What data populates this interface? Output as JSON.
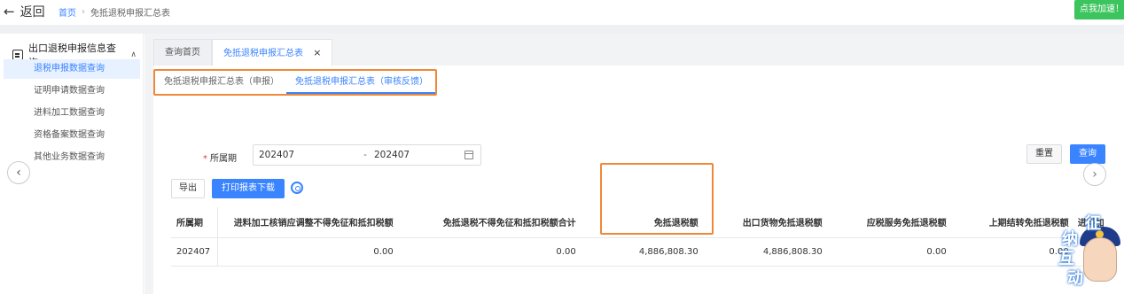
{
  "topbar": {
    "back_label": "返回",
    "back_icon": "left-arrow-icon",
    "breadcrumb": {
      "home": "首页",
      "current": "免抵退税申报汇总表"
    },
    "speed_button": "点我加速！"
  },
  "sidebar": {
    "header": "出口退税申报信息查询",
    "items": [
      {
        "label": "退税申报数据查询",
        "active": true
      },
      {
        "label": "证明申请数据查询",
        "active": false
      },
      {
        "label": "进料加工数据查询",
        "active": false
      },
      {
        "label": "资格备案数据查询",
        "active": false
      },
      {
        "label": "其他业务数据查询",
        "active": false
      }
    ]
  },
  "tabs": [
    {
      "label": "查询首页",
      "active": false
    },
    {
      "label": "免抵退税申报汇总表",
      "active": true,
      "closable": true
    }
  ],
  "subtabs": [
    {
      "label": "免抵退税申报汇总表（申报）",
      "active": false
    },
    {
      "label": "免抵退税申报汇总表（审核反馈）",
      "active": true
    }
  ],
  "filter": {
    "period_label": "所属期",
    "start": "202407",
    "separator": "-",
    "end": "202407"
  },
  "buttons": {
    "reset": "重置",
    "query": "查询",
    "export": "导出",
    "print_download": "打印报表下载"
  },
  "table": {
    "headers": [
      "所属期",
      "进料加工核销应调整不得免征和抵扣税额",
      "免抵退税不得免征和抵扣税额合计",
      "免抵退税额",
      "出口货物免抵退税额",
      "应税服务免抵退税额",
      "上期结转免抵退税额",
      "进料加"
    ],
    "rows": [
      [
        "202407",
        "0.00",
        "0.00",
        "4,886,808.30",
        "4,886,808.30",
        "0.00",
        "0.00",
        ""
      ]
    ]
  },
  "mascot": {
    "characters": [
      "征",
      "纳",
      "互",
      "动"
    ]
  },
  "colors": {
    "accent": "#3a84ff",
    "highlight_border": "#f0883a",
    "speed_green": "#3cc55e"
  }
}
